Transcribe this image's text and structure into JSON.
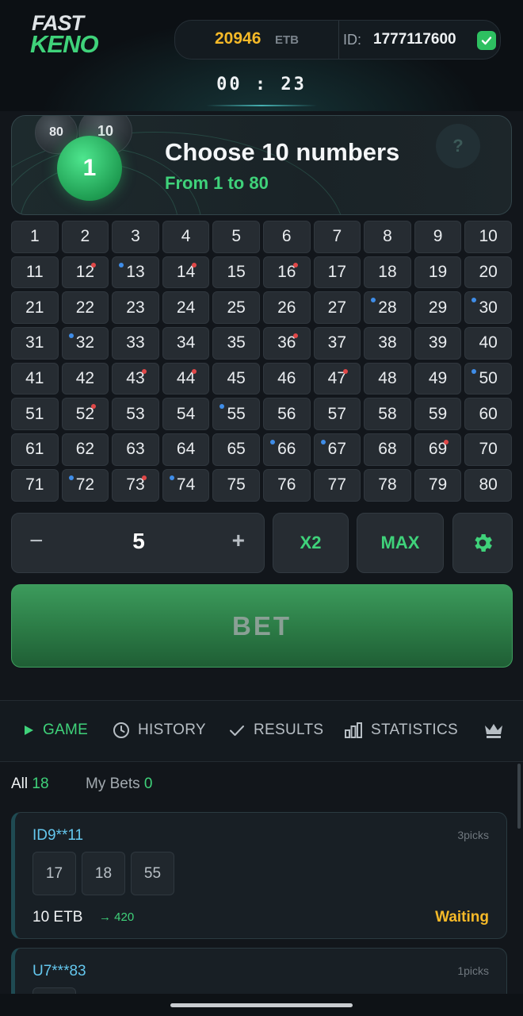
{
  "header": {
    "logo_line1": "FAST",
    "logo_line2": "KENO",
    "balance": "20946",
    "currency": "ETB",
    "id_label": "ID:",
    "id_value": "1777117600",
    "timer": "00 : 23"
  },
  "choose": {
    "ball_main": "1",
    "ball_left": "80",
    "ball_right": "10",
    "title": "Choose 10 numbers",
    "subtitle": "From 1 to 80",
    "help": "?"
  },
  "grid": {
    "numbers": [
      1,
      2,
      3,
      4,
      5,
      6,
      7,
      8,
      9,
      10,
      11,
      12,
      13,
      14,
      15,
      16,
      17,
      18,
      19,
      20,
      21,
      22,
      23,
      24,
      25,
      26,
      27,
      28,
      29,
      30,
      31,
      32,
      33,
      34,
      35,
      36,
      37,
      38,
      39,
      40,
      41,
      42,
      43,
      44,
      45,
      46,
      47,
      48,
      49,
      50,
      51,
      52,
      53,
      54,
      55,
      56,
      57,
      58,
      59,
      60,
      61,
      62,
      63,
      64,
      65,
      66,
      67,
      68,
      69,
      70,
      71,
      72,
      73,
      74,
      75,
      76,
      77,
      78,
      79,
      80
    ],
    "red_dots": [
      12,
      14,
      16,
      36,
      43,
      44,
      47,
      52,
      69,
      73
    ],
    "blue_dots": [
      13,
      28,
      30,
      32,
      50,
      55,
      66,
      67,
      72,
      74
    ]
  },
  "controls": {
    "minus": "−",
    "stake": "5",
    "plus": "+",
    "x2": "X2",
    "max": "MAX",
    "bet": "BET"
  },
  "tabs": [
    {
      "label": "GAME",
      "icon": "play-icon",
      "active": true
    },
    {
      "label": "HISTORY",
      "icon": "clock-icon",
      "active": false
    },
    {
      "label": "RESULTS",
      "icon": "check-icon",
      "active": false
    },
    {
      "label": "STATISTICS",
      "icon": "bar-chart-icon",
      "active": false
    },
    {
      "label": "",
      "icon": "crown-icon",
      "active": false
    }
  ],
  "filters": {
    "all_label": "All",
    "all_count": "18",
    "my_label": "My Bets",
    "my_count": "0"
  },
  "bets": [
    {
      "id": "ID9**11",
      "picks": "3picks",
      "numbers": [
        "17",
        "18",
        "55"
      ],
      "amount": "10 ETB",
      "win": "→ 420",
      "status": "Waiting"
    },
    {
      "id": "U7***83",
      "picks": "1picks"
    }
  ],
  "colors": {
    "accent": "#3fd27a",
    "balance": "#f5b928",
    "red_dot": "#e04848",
    "blue_dot": "#3f8de8"
  }
}
